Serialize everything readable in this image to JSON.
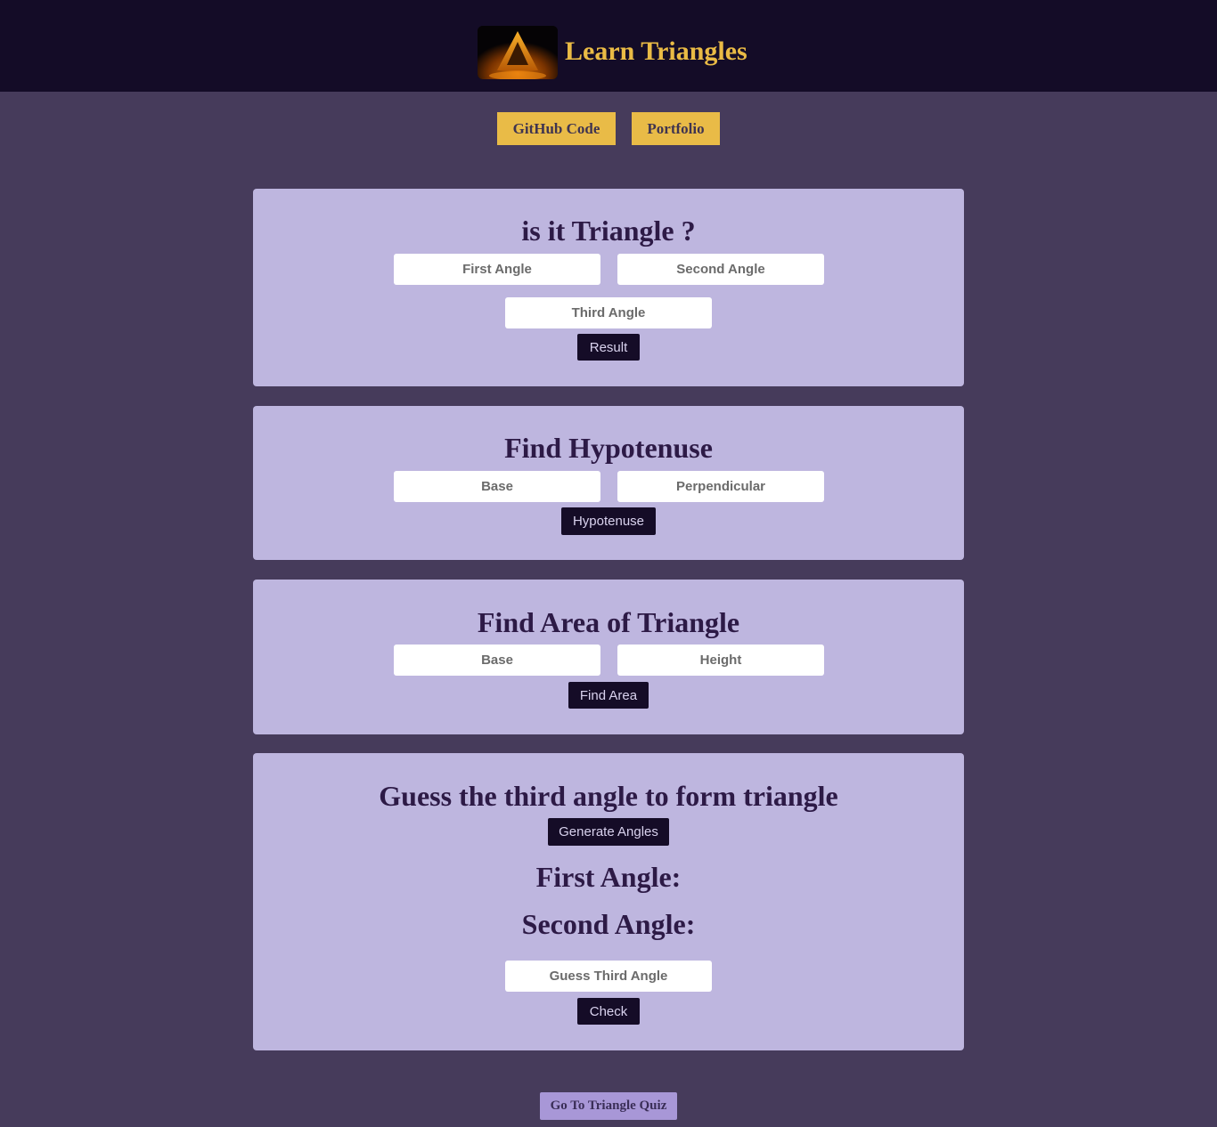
{
  "header": {
    "title": "Learn Triangles",
    "logo_icon": "triangle-logo-icon",
    "links": {
      "github_label": "GitHub Code",
      "portfolio_label": "Portfolio"
    }
  },
  "is_triangle": {
    "title": "is it Triangle ?",
    "first_angle_placeholder": "First Angle",
    "second_angle_placeholder": "Second Angle",
    "third_angle_placeholder": "Third Angle",
    "button_label": "Result"
  },
  "hypotenuse": {
    "title": "Find Hypotenuse",
    "base_placeholder": "Base",
    "perpendicular_placeholder": "Perpendicular",
    "button_label": "Hypotenuse"
  },
  "area": {
    "title": "Find Area of Triangle",
    "base_placeholder": "Base",
    "height_placeholder": "Height",
    "button_label": "Find Area"
  },
  "guess": {
    "title": "Guess the third angle to form triangle",
    "generate_label": "Generate Angles",
    "first_angle_label": "First Angle:",
    "second_angle_label": "Second Angle:",
    "guess_placeholder": "Guess Third Angle",
    "check_label": "Check"
  },
  "footer": {
    "quiz_label": "Go To Triangle Quiz"
  },
  "colors": {
    "page_bg": "#463b5b",
    "header_bg": "#140c27",
    "accent_gold": "#e9bb47",
    "card_bg": "#beb6df",
    "dark_button": "#150c27",
    "quiz_button": "#a897d7"
  }
}
